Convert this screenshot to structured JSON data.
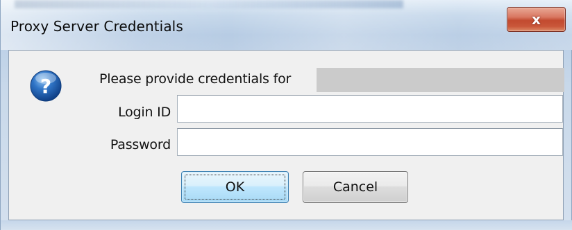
{
  "window": {
    "title": "Proxy Server Credentials",
    "close_label": "x"
  },
  "dialog": {
    "icon": "question-icon",
    "prompt": "Please provide credentials for",
    "login": {
      "label": "Login ID",
      "value": ""
    },
    "password": {
      "label": "Password",
      "value": ""
    },
    "buttons": {
      "ok": "OK",
      "cancel": "Cancel"
    }
  },
  "colors": {
    "accent": "#3c7fb1",
    "close_red": "#c24a2f",
    "icon_blue": "#1f5fae"
  }
}
